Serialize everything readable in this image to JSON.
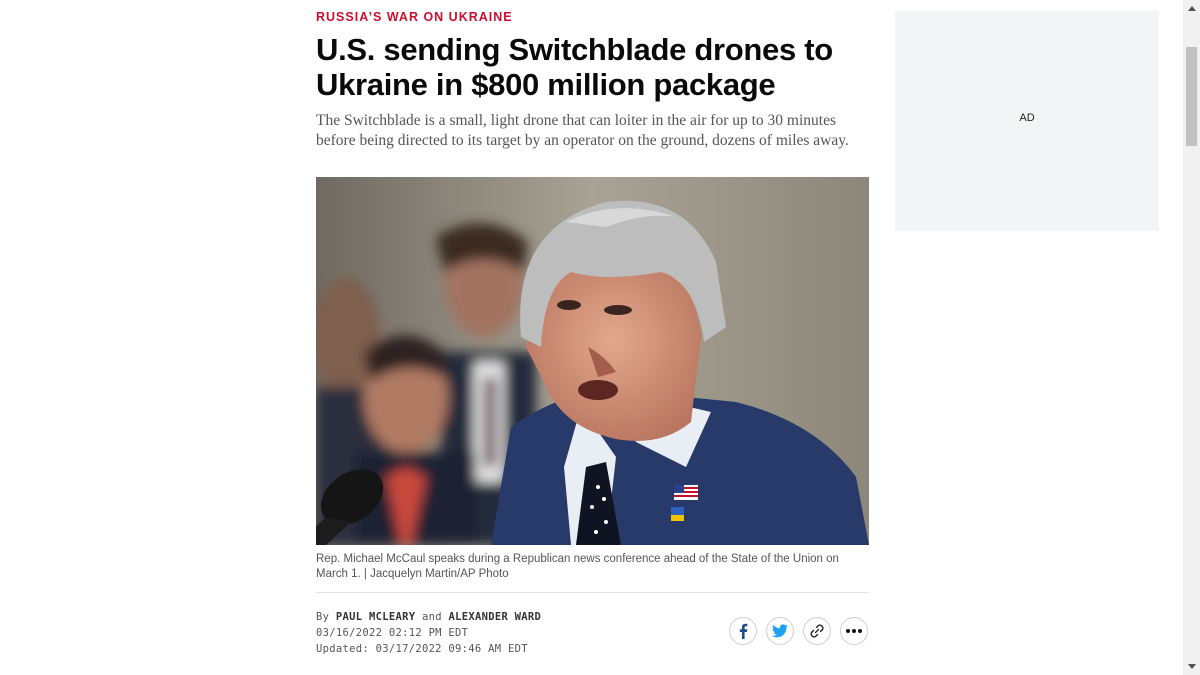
{
  "article": {
    "kicker": "RUSSIA’S WAR ON UKRAINE",
    "headline": "U.S. sending Switchblade drones to Ukraine in $800 million package",
    "dek": "The Switchblade is a small, light drone that can loiter in the air for up to 30 minutes before being directed to its target by an operator on the ground, dozens of miles away.",
    "caption": "Rep. Michael McCaul speaks during a Republican news conference ahead of the State of the Union on March 1. | Jacquelyn Martin/AP Photo",
    "byline": {
      "by": "By",
      "author1": "PAUL MCLEARY",
      "and": "and",
      "author2": "ALEXANDER WARD",
      "published": "03/16/2022 02:12 PM EDT",
      "updated": "Updated: 03/17/2022 09:46 AM EDT"
    }
  },
  "share": {
    "facebook_icon": "facebook-icon",
    "twitter_icon": "twitter-icon",
    "link_icon": "link-icon",
    "more_icon": "more-icon"
  },
  "ad": {
    "label": "AD"
  },
  "colors": {
    "kicker": "#c8102e",
    "facebook": "#1d4c8f",
    "twitter": "#1da1f2",
    "ad_background": "#f3f4f6"
  }
}
